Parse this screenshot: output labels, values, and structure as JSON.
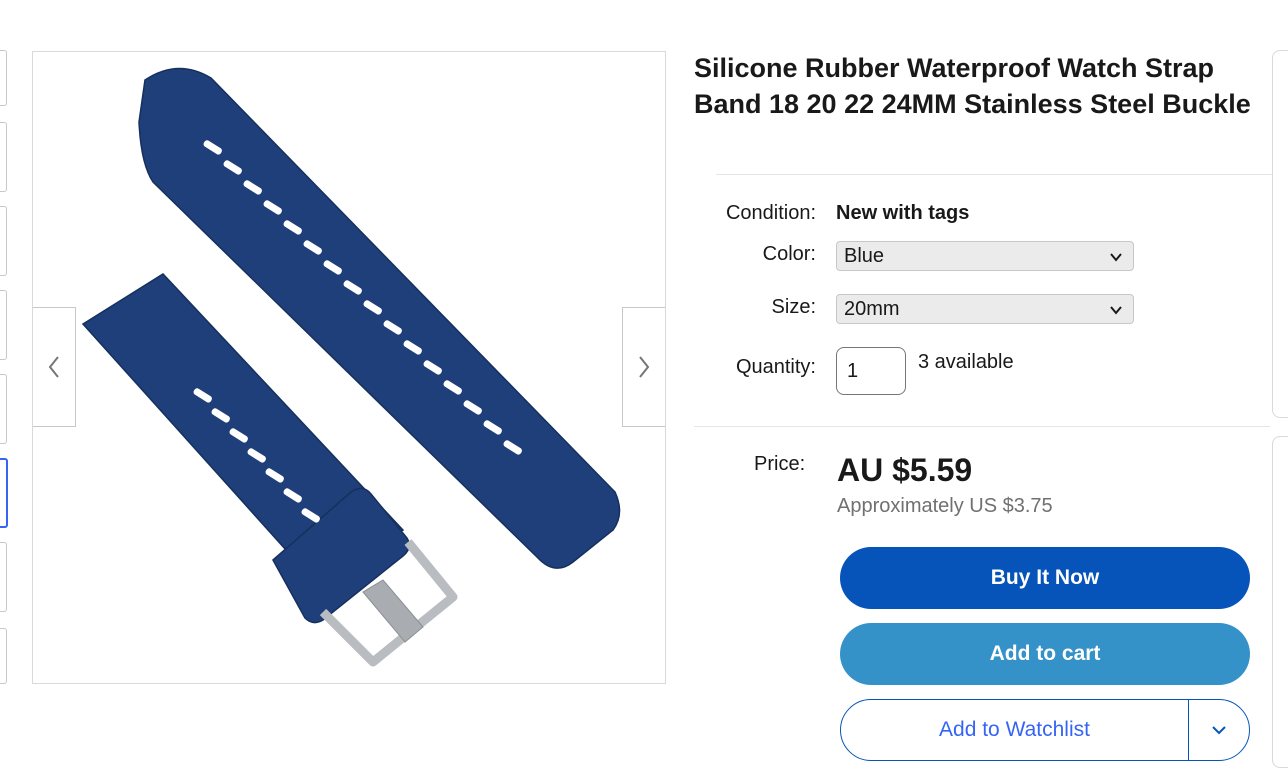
{
  "product": {
    "title": "Silicone Rubber Waterproof Watch Strap Band 18 20 22 24MM Stainless Steel Buckle",
    "image_alt": "Blue silicone watch strap with stainless steel buckle"
  },
  "details": {
    "condition_label": "Condition:",
    "condition_value": "New with tags",
    "color_label": "Color:",
    "color_selected": "Blue",
    "size_label": "Size:",
    "size_selected": "20mm",
    "quantity_label": "Quantity:",
    "quantity_value": "1",
    "available_text": "3 available"
  },
  "pricing": {
    "price_label": "Price:",
    "price": "AU $5.59",
    "approx": "Approximately US $3.75"
  },
  "actions": {
    "buy_now": "Buy It Now",
    "add_to_cart": "Add to cart",
    "add_to_watchlist": "Add to Watchlist"
  },
  "icons": {
    "prev": "chevron-left-icon",
    "next": "chevron-right-icon",
    "dropdown": "chevron-down-icon"
  },
  "colors": {
    "strap": "#1f3f7a",
    "buy_button": "#0654ba",
    "cart_button": "#3592c9",
    "link_blue": "#3665f3"
  }
}
